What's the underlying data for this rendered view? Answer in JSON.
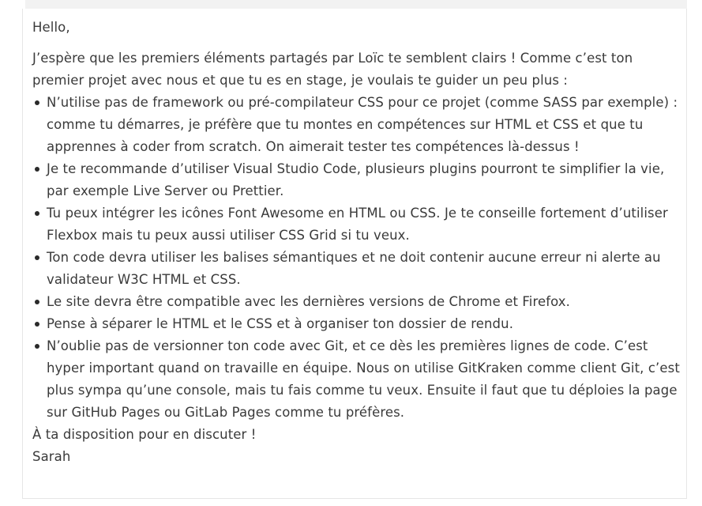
{
  "message": {
    "greeting": "Hello,",
    "intro": "J’espère que les premiers éléments partagés par Loïc te semblent clairs ! Comme c’est ton premier projet avec nous et que tu es en stage, je voulais te guider un peu plus :",
    "tips": [
      "N’utilise pas de framework ou pré-compilateur CSS pour ce projet (comme SASS par exemple) : comme tu démarres, je préfère que tu montes en compétences sur HTML et CSS et que tu apprennes à coder from scratch. On aimerait tester tes compétences là-dessus !",
      "Je te recommande d’utiliser Visual Studio Code, plusieurs plugins pourront te simplifier la vie, par exemple Live Server ou Prettier.",
      "Tu peux intégrer les icônes Font Awesome en HTML ou CSS. Je te conseille fortement d’utiliser Flexbox mais tu peux aussi utiliser CSS Grid si tu veux.",
      "Ton code devra utiliser les balises sémantiques et ne doit contenir aucune erreur ni alerte au validateur W3C HTML et CSS.",
      "Le site devra être compatible avec les dernières versions de Chrome et Firefox.",
      "Pense à séparer le HTML et le CSS et à organiser ton dossier de rendu.",
      "N’oublie pas de versionner ton code avec Git, et ce dès les premières lignes de code. C’est hyper important quand on travaille en équipe. Nous on utilise GitKraken comme client Git, c’est plus sympa qu’une console, mais tu fais comme tu veux. Ensuite il faut que tu déploies la page sur GitHub Pages ou GitLab Pages comme tu préfères."
    ],
    "closing": "À ta disposition pour en discuter !",
    "signature": "Sarah"
  }
}
